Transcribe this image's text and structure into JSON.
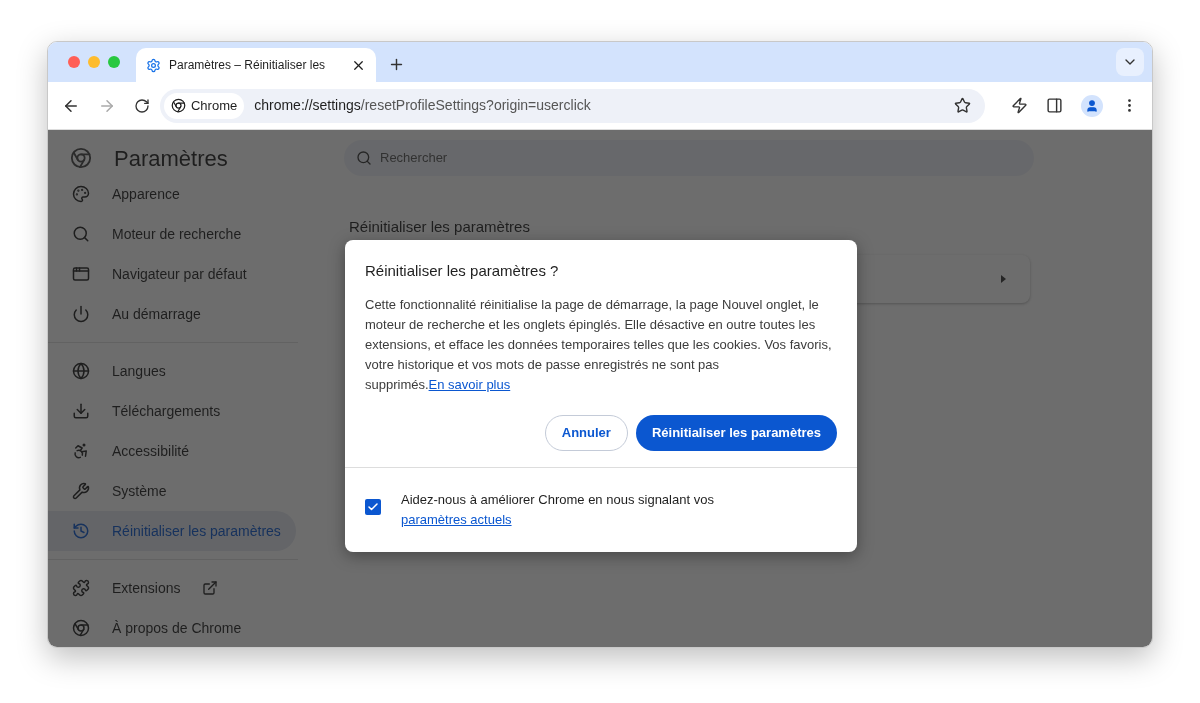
{
  "tab": {
    "title": "Paramètres – Réinitialiser les",
    "selected": true
  },
  "address_bar": {
    "chip": "Chrome",
    "url_host": "chrome://settings",
    "url_path": "/resetProfileSettings?origin=userclick"
  },
  "settings": {
    "title": "Paramètres",
    "search": {
      "placeholder": "Rechercher"
    },
    "sidebar": {
      "sections": [
        {
          "items": [
            {
              "label": "Apparence",
              "selected": false
            },
            {
              "label": "Moteur de recherche",
              "selected": false
            },
            {
              "label": "Navigateur par défaut",
              "selected": false
            },
            {
              "label": "Au démarrage",
              "selected": false
            }
          ]
        },
        {
          "items": [
            {
              "label": "Langues",
              "selected": false
            },
            {
              "label": "Téléchargements",
              "selected": false
            },
            {
              "label": "Accessibilité",
              "selected": false
            },
            {
              "label": "Système",
              "selected": false
            },
            {
              "label": "Réinitialiser les paramètres",
              "selected": true
            }
          ]
        },
        {
          "items": [
            {
              "label": "Extensions",
              "selected": false,
              "external": true
            },
            {
              "label": "À propos de Chrome",
              "selected": false,
              "external": false
            }
          ]
        }
      ]
    },
    "section_title": "Réinitialiser les paramètres"
  },
  "dialog": {
    "title": "Réinitialiser les paramètres ?",
    "body": "Cette fonctionnalité réinitialise la page de démarrage, la page Nouvel onglet, le moteur de recherche et les onglets épinglés. Elle désactive en outre toutes les extensions, et efface les données temporaires telles que les cookies. Vos favoris, votre historique et vos mots de passe enregistrés ne sont pas supprimés.",
    "link": "En savoir plus",
    "buttons": [
      {
        "label": "Annuler",
        "kind": "secondary"
      },
      {
        "label": "Réinitialiser les paramètres",
        "kind": "primary"
      }
    ],
    "footer": {
      "checked": true,
      "text": "Aidez-nous à améliorer Chrome en nous signalant vos",
      "link": "paramètres actuels"
    }
  }
}
